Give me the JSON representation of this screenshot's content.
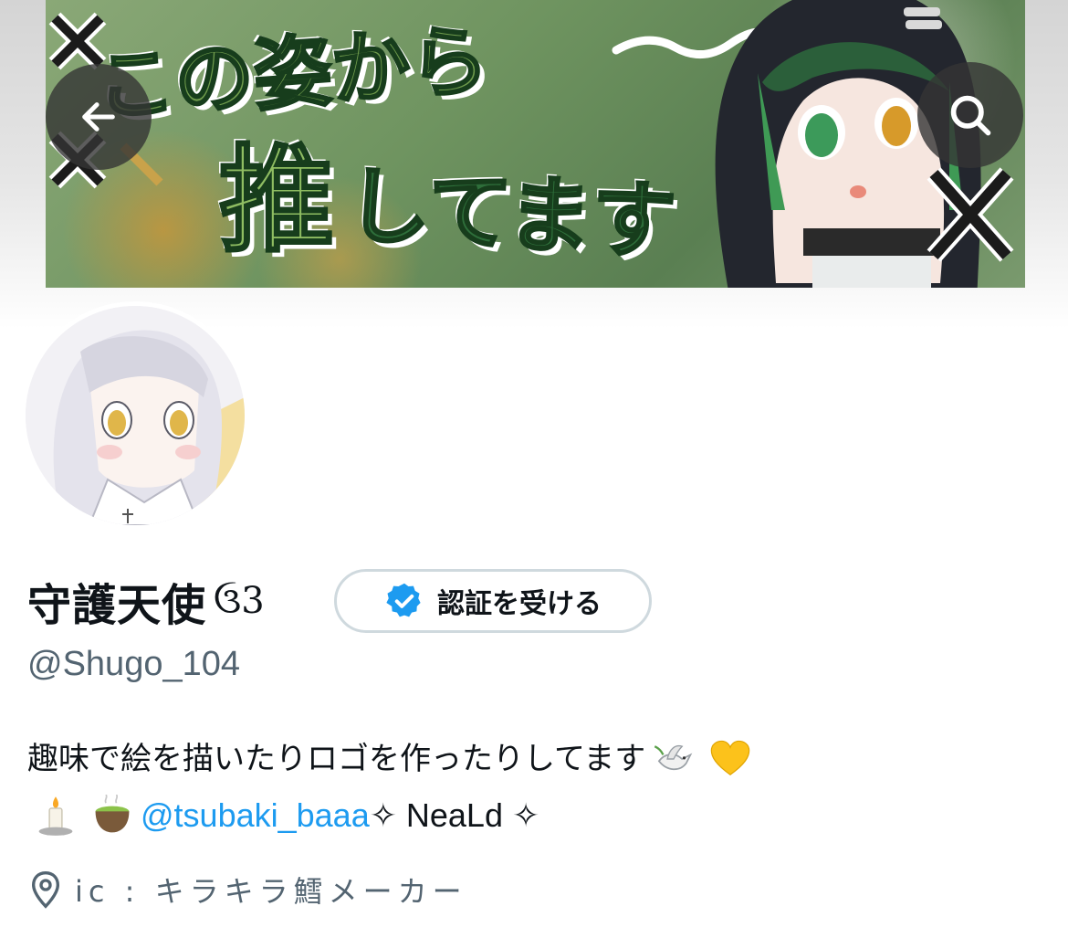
{
  "header": {
    "banner_text": [
      "この姿から",
      "推",
      "してます"
    ],
    "back_icon": "arrow-left-icon",
    "search_icon": "search-icon"
  },
  "profile": {
    "display_name": "守護天使",
    "name_emoji": "ઉ3",
    "verify_button_label": "認証を受ける",
    "verify_icon": "verified-badge-icon",
    "handle": "@Shugo_104",
    "bio": {
      "line1_text": "趣味で絵を描いたりロゴを作ったりしてます",
      "line1_emojis": [
        "dove-icon",
        "yellow-heart-icon"
      ],
      "line2_emojis": [
        "candle-icon",
        "green-tea-icon"
      ],
      "mention": "@tsubaki_baaa",
      "line2_suffix": " ✧ NeaLd ✧",
      "line2_prefix_sparkle": " ✧"
    },
    "location_icon": "location-pin-icon",
    "location": "ic : キラキラ鱈メーカー"
  },
  "colors": {
    "accent": "#1d9bf0",
    "secondary_text": "#536471",
    "border": "#cfd9de"
  }
}
